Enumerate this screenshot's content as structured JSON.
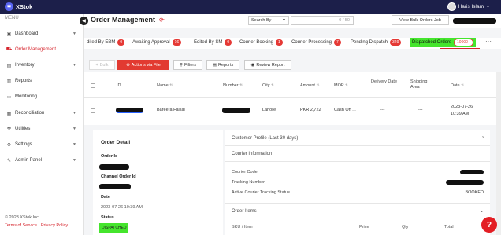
{
  "brand": {
    "name": "XStok"
  },
  "user": {
    "name": "Haris Islam"
  },
  "sidebar": {
    "menu_label": "MENU",
    "items": [
      {
        "label": "Dashboard",
        "icon": "dashboard-icon",
        "chevron": true
      },
      {
        "label": "Order Management",
        "icon": "cart-icon",
        "active": true
      },
      {
        "label": "Inventory",
        "icon": "box-icon",
        "chevron": true
      },
      {
        "label": "Reports",
        "icon": "report-icon"
      },
      {
        "label": "Monitoring",
        "icon": "monitor-icon"
      },
      {
        "label": "Reconciliation",
        "icon": "reconcile-icon",
        "chevron": true
      },
      {
        "label": "Utilities",
        "icon": "tools-icon",
        "chevron": true
      },
      {
        "label": "Settings",
        "icon": "gear-icon",
        "chevron": true
      },
      {
        "label": "Admin Panel",
        "icon": "admin-icon",
        "chevron": true
      }
    ],
    "copyright": "© 2023 XStok Inc.",
    "terms": "Terms of Service",
    "separator": " · ",
    "privacy": "Privacy Policy"
  },
  "header": {
    "title": "Order Management",
    "search_by": "Search By",
    "search_count": "0 / 50",
    "bulk_button": "View Bulk Orders Job"
  },
  "tabs": [
    {
      "label": "dited By EBM",
      "count": "0"
    },
    {
      "label": "Awaiting Approval",
      "count": "16"
    },
    {
      "label": "Edited By SM",
      "count": "0"
    },
    {
      "label": "Courier Booking",
      "count": "1"
    },
    {
      "label": "Courier Processing",
      "count": "7"
    },
    {
      "label": "Pending Dispatch",
      "count": "329"
    },
    {
      "label": "Dispatched Orders",
      "count": "10000+",
      "active": true
    }
  ],
  "toolbar": {
    "bulk": "Bulk",
    "actions": "Actions via File",
    "filters": "Filters",
    "reports": "Reports",
    "review": "Review Report"
  },
  "table": {
    "headers": [
      "ID",
      "Name",
      "Number",
      "City",
      "Amount",
      "MOP",
      "Delivery Date",
      "Shipping Area",
      "Date"
    ],
    "row": {
      "name": "Bareera Faisal",
      "city": "Lahore",
      "amount": "PKR 2,722",
      "mop": "Cash On ...",
      "delivery_date": "---",
      "shipping_area": "---",
      "date": "2023-07-26",
      "time": "10:39 AM"
    }
  },
  "order_detail": {
    "title": "Order Detail",
    "order_id_label": "Order Id",
    "channel_order_id_label": "Channel Order Id",
    "date_label": "Date",
    "date_value": "2023-07-26 10:39 AM",
    "status_label": "Status",
    "status_value": "DISPATCHED"
  },
  "right_panel": {
    "customer_profile": "Customer Profile (Last 30 days)",
    "courier_info": "Courier Information",
    "courier_code": "Courier Code",
    "tracking_number": "Tracking Number",
    "tracking_status_label": "Active Courier Tracking Status",
    "tracking_status_value": "BOOKED",
    "order_items": "Order Items",
    "items_headers": [
      "SKU / Item",
      "Price",
      "Qty",
      "Total"
    ]
  },
  "help": "?"
}
